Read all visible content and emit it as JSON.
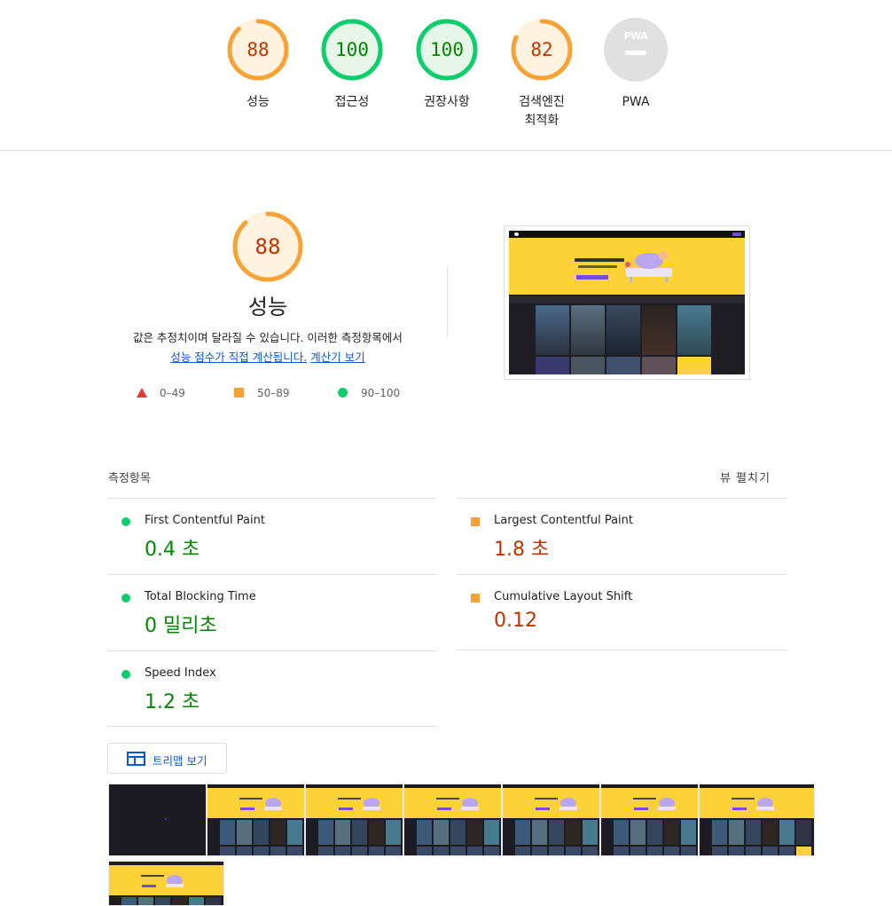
{
  "summary": [
    {
      "score": "88",
      "label": "성능",
      "status": "average",
      "fraction": 0.88
    },
    {
      "score": "100",
      "label": "접근성",
      "status": "pass",
      "fraction": 1.0
    },
    {
      "score": "100",
      "label": "권장사항",
      "status": "pass",
      "fraction": 1.0
    },
    {
      "score": "82",
      "label_line1": "검색엔진",
      "label_line2": "최적화",
      "status": "average",
      "fraction": 0.82
    },
    {
      "badge": "PWA",
      "label": "PWA",
      "status": "na"
    }
  ],
  "performance": {
    "score": "88",
    "fraction": 0.88,
    "title": "성능",
    "desc_line1": "값은 추정치이며 달라질 수 있습니다. 이러한 측정항목에서",
    "link1": "성능 점수가 직접 계산됩니다.",
    "link2": "계산기 보기",
    "legend": [
      {
        "range": "0–49",
        "shape": "triangle",
        "color": "#e53935"
      },
      {
        "range": "50–89",
        "shape": "square",
        "color": "#f6a237"
      },
      {
        "range": "90–100",
        "shape": "circle",
        "color": "#0cce6b"
      }
    ]
  },
  "metrics": {
    "heading": "측정항목",
    "expand_label": "뷰 펼치기",
    "items": [
      {
        "name": "First Contentful Paint",
        "value": "0.4 초",
        "status": "pass"
      },
      {
        "name": "Largest Contentful Paint",
        "value": "1.8 초",
        "status": "average"
      },
      {
        "name": "Total Blocking Time",
        "value": "0 밀리초",
        "status": "pass"
      },
      {
        "name": "Cumulative Layout Shift",
        "value": "0.12",
        "status": "average"
      },
      {
        "name": "Speed Index",
        "value": "1.2 초",
        "status": "pass"
      }
    ]
  },
  "treemap_label": "트리맵 보기",
  "colors": {
    "pass": "#0cce6b",
    "pass_text": "#008800",
    "average": "#f6a237",
    "average_text": "#c33300",
    "fail": "#e53935",
    "link": "#0b57d0",
    "banner": "#fdd237",
    "accent": "#6e4de0"
  }
}
